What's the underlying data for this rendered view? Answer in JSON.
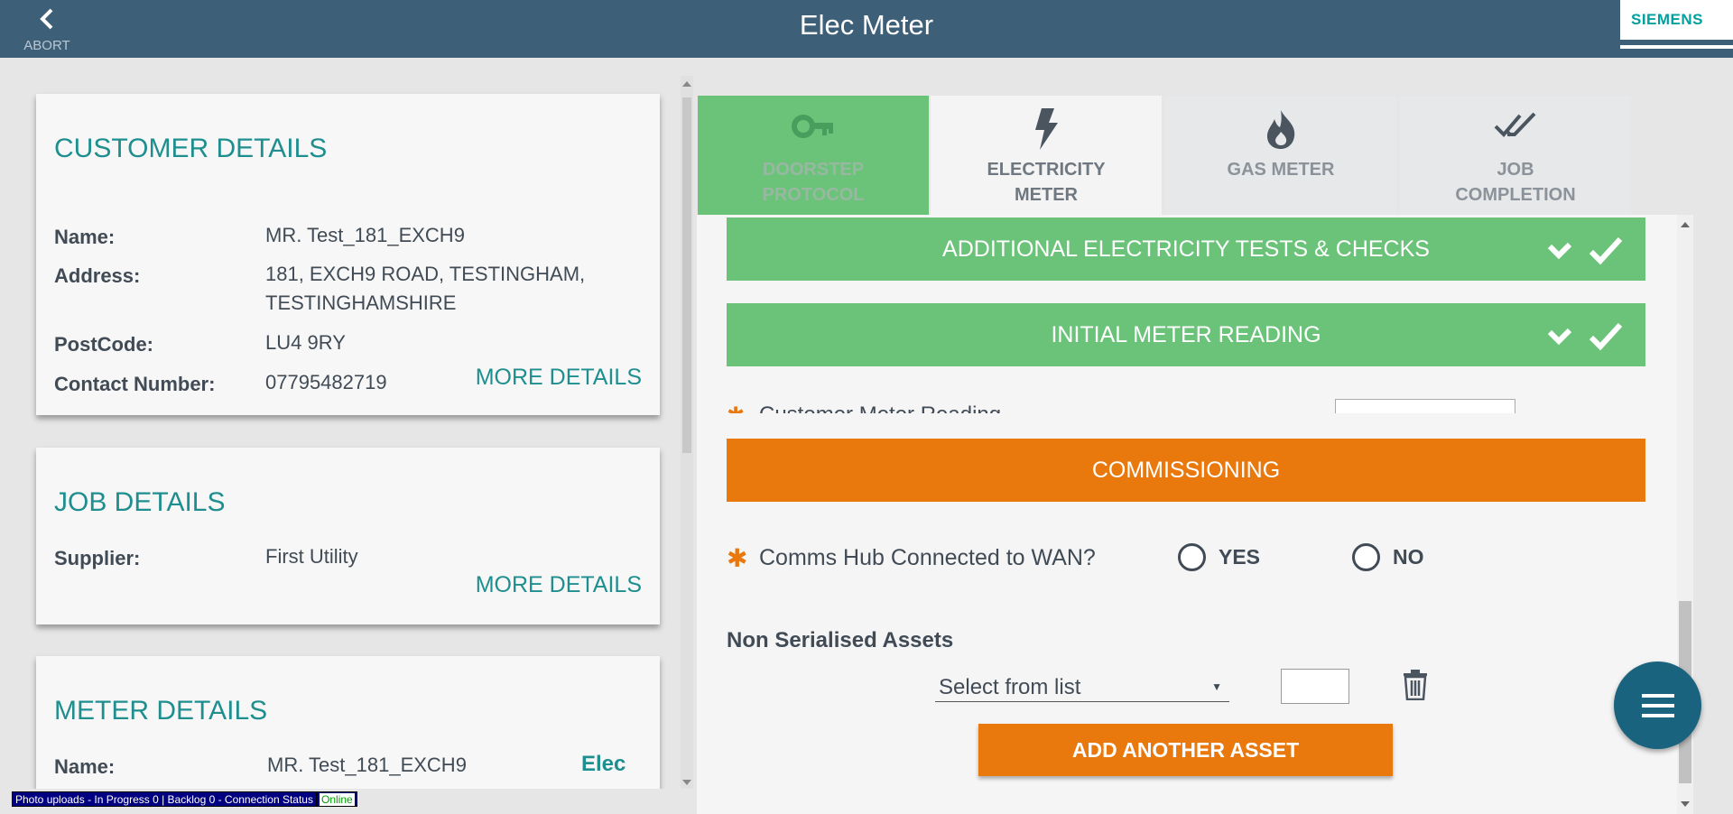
{
  "header": {
    "abort_label": "ABORT",
    "title": "Elec Meter",
    "brand": "SIEMENS"
  },
  "customer_details": {
    "title": "CUSTOMER DETAILS",
    "name_label": "Name:",
    "name_value": "MR. Test_181_EXCH9",
    "address_label": "Address:",
    "address_value": "181, EXCH9 ROAD, TESTINGHAM, TESTINGHAMSHIRE",
    "postcode_label": "PostCode:",
    "postcode_value": "LU4 9RY",
    "contact_label": "Contact Number:",
    "contact_value": "07795482719",
    "more_label": "MORE DETAILS"
  },
  "job_details": {
    "title": "JOB DETAILS",
    "supplier_label": "Supplier:",
    "supplier_value": "First Utility",
    "more_label": "MORE DETAILS"
  },
  "meter_details": {
    "title": "METER DETAILS",
    "name_label": "Name:",
    "name_value": "MR. Test_181_EXCH9",
    "type_tag": "Elec"
  },
  "tabs": [
    {
      "label_line1": "DOORSTEP",
      "label_line2": "PROTOCOL",
      "icon": "key-icon"
    },
    {
      "label_line1": "ELECTRICITY",
      "label_line2": "METER",
      "icon": "lightning-icon"
    },
    {
      "label_line1": "GAS METER",
      "label_line2": "",
      "icon": "flame-icon"
    },
    {
      "label_line1": "JOB",
      "label_line2": "COMPLETION",
      "icon": "double-check-icon"
    }
  ],
  "sections": {
    "additional_tests": "ADDITIONAL ELECTRICITY TESTS & CHECKS",
    "initial_reading": "INITIAL METER READING",
    "partial_row_text": "Customer Meter Reading",
    "commissioning": "COMMISSIONING"
  },
  "comms": {
    "question": "Comms Hub Connected to WAN?",
    "yes_label": "YES",
    "no_label": "NO"
  },
  "assets": {
    "title": "Non Serialised Assets",
    "select_value": "Select from list",
    "add_label": "ADD ANOTHER ASSET"
  },
  "status_bar": {
    "text": "Photo uploads - In Progress 0 | Backlog 0 - Connection Status",
    "connection": "Online"
  },
  "colors": {
    "header": "#3e5f78",
    "accent_teal": "#1f8e8f",
    "green": "#6bc37a",
    "orange": "#e9780d",
    "fab": "#19637e"
  }
}
